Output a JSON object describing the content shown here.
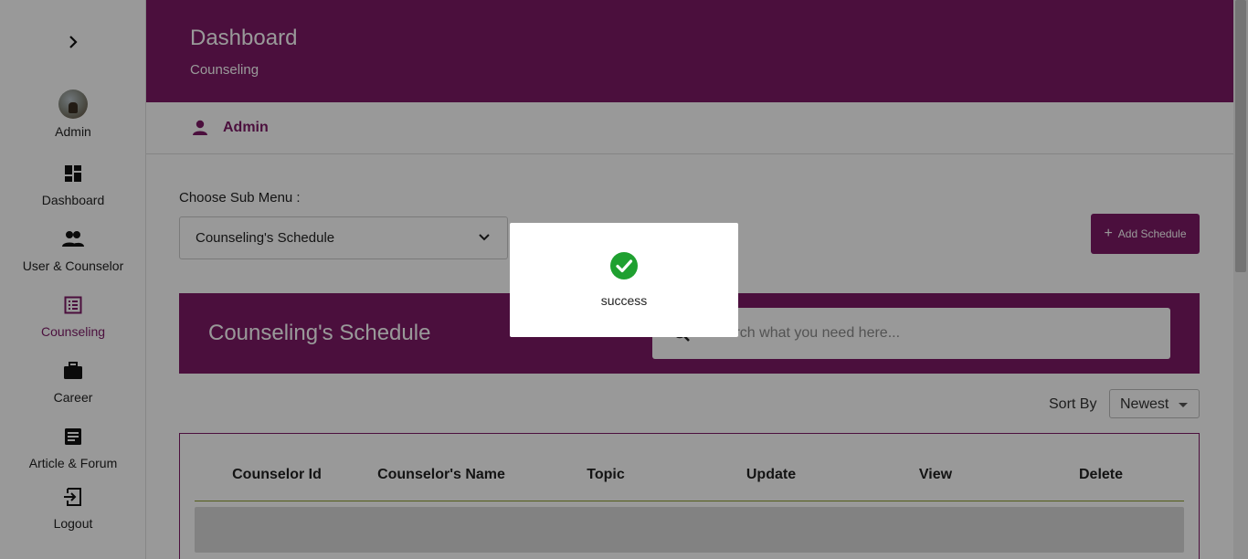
{
  "sidebar": {
    "items": [
      {
        "label": "Admin",
        "icon": "avatar"
      },
      {
        "label": "Dashboard",
        "icon": "dashboard-icon"
      },
      {
        "label": "User & Counselor",
        "icon": "people-icon"
      },
      {
        "label": "Counseling",
        "icon": "list-alt-icon",
        "active": true
      },
      {
        "label": "Career",
        "icon": "briefcase-icon"
      },
      {
        "label": "Article & Forum",
        "icon": "article-icon"
      },
      {
        "label": "Logout",
        "icon": "logout-icon"
      }
    ]
  },
  "header": {
    "title": "Dashboard",
    "subtitle": "Counseling"
  },
  "userbar": {
    "name": "Admin"
  },
  "main": {
    "choose_label": "Choose Sub Menu :",
    "submenu_value": "Counseling's Schedule",
    "add_button": "Add Schedule",
    "banner_title": "Counseling's Schedule",
    "search_placeholder": "Search what you need here...",
    "sort_label": "Sort By",
    "sort_value": "Newest",
    "table_headers": [
      "Counselor Id",
      "Counselor's Name",
      "Topic",
      "Update",
      "View",
      "Delete"
    ]
  },
  "modal": {
    "message": "success"
  },
  "colors": {
    "brand": "#7d1a67",
    "success": "#1fa030"
  }
}
